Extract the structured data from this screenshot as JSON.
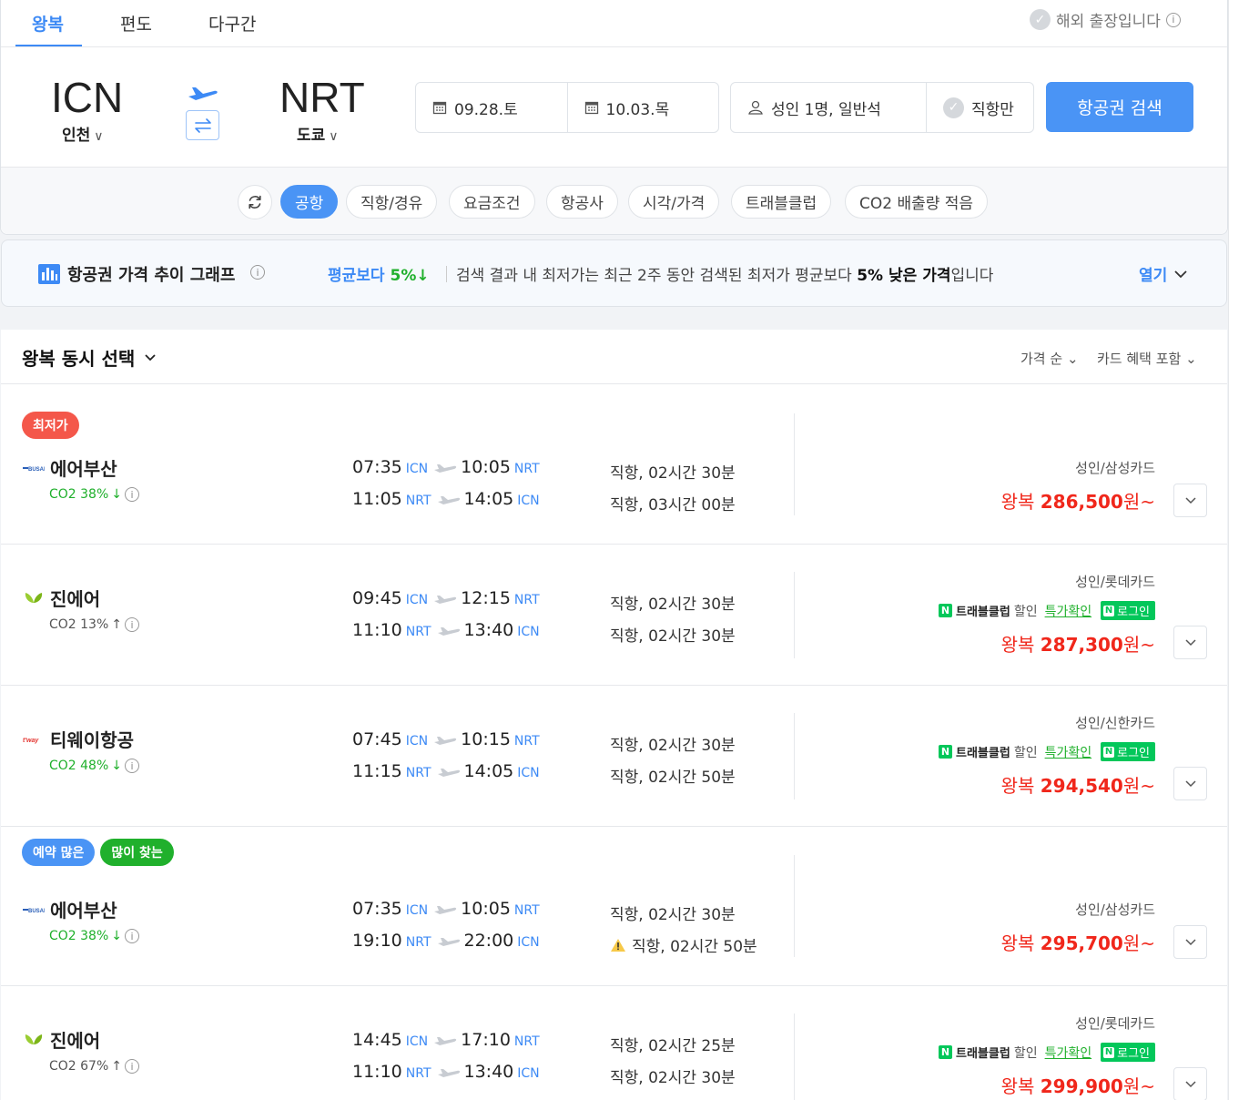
{
  "trip_tabs": [
    "왕복",
    "편도",
    "다구간"
  ],
  "business_trip": {
    "label": "해외 출장입니다"
  },
  "origin": {
    "code": "ICN",
    "city": "인천"
  },
  "destination": {
    "code": "NRT",
    "city": "도쿄"
  },
  "dates": {
    "depart": "09.28.토",
    "return": "10.03.목"
  },
  "passengers": "성인 1명, 일반석",
  "direct_only": "직항만",
  "search_button": "항공권 검색",
  "filters": [
    "공항",
    "직항/경유",
    "요금조건",
    "항공사",
    "시각/가격",
    "트래블클럽",
    "CO2 배출량 적음"
  ],
  "trend": {
    "title": "항공권 가격 추이 그래프",
    "compare_label": "평균보다",
    "compare_pct": "5%",
    "message_pre": "검색 결과 내 최저가는 최근 2주 동안 검색된 최저가 평균보다 ",
    "message_bold": "5% 낮은 가격",
    "message_post": "입니다",
    "open_label": "열기"
  },
  "results_header": {
    "mode": "왕복 동시 선택",
    "sort": "가격 순",
    "card": "카드 혜택 포함"
  },
  "promo": {
    "club": "트래블클럽",
    "discount": "할인",
    "link": "특가확인",
    "login": "로그인"
  },
  "colors": {
    "accent": "#4a94f5",
    "price": "#f0271b",
    "green": "#20b02c",
    "badge_red": "#f4574a"
  },
  "flights": [
    {
      "badges": [
        {
          "text": "최저가",
          "color": "red"
        }
      ],
      "airline": "에어부산",
      "logo": "airbusan-logo",
      "co2": "CO2 38%",
      "co2_dir": "down",
      "out": {
        "dep_time": "07:35",
        "dep_ap": "ICN",
        "arr_time": "10:05",
        "arr_ap": "NRT",
        "dur": "직항, 02시간 30분"
      },
      "ret": {
        "dep_time": "11:05",
        "dep_ap": "NRT",
        "arr_time": "14:05",
        "arr_ap": "ICN",
        "dur": "직항, 03시간 00분"
      },
      "card": "성인/삼성카드",
      "promo": false,
      "price_prefix": "왕복",
      "price": "286,500",
      "price_suffix": "원~"
    },
    {
      "badges": [],
      "airline": "진에어",
      "logo": "jinair-logo",
      "co2": "CO2 13%",
      "co2_dir": "up",
      "out": {
        "dep_time": "09:45",
        "dep_ap": "ICN",
        "arr_time": "12:15",
        "arr_ap": "NRT",
        "dur": "직항, 02시간 30분"
      },
      "ret": {
        "dep_time": "11:10",
        "dep_ap": "NRT",
        "arr_time": "13:40",
        "arr_ap": "ICN",
        "dur": "직항, 02시간 30분"
      },
      "card": "성인/롯데카드",
      "promo": true,
      "price_prefix": "왕복",
      "price": "287,300",
      "price_suffix": "원~"
    },
    {
      "badges": [],
      "airline": "티웨이항공",
      "logo": "tway-logo",
      "co2": "CO2 48%",
      "co2_dir": "down",
      "out": {
        "dep_time": "07:45",
        "dep_ap": "ICN",
        "arr_time": "10:15",
        "arr_ap": "NRT",
        "dur": "직항, 02시간 30분"
      },
      "ret": {
        "dep_time": "11:15",
        "dep_ap": "NRT",
        "arr_time": "14:05",
        "arr_ap": "ICN",
        "dur": "직항, 02시간 50분"
      },
      "card": "성인/신한카드",
      "promo": true,
      "price_prefix": "왕복",
      "price": "294,540",
      "price_suffix": "원~"
    },
    {
      "badges": [
        {
          "text": "예약 많은",
          "color": "blue"
        },
        {
          "text": "많이 찾는",
          "color": "green"
        }
      ],
      "airline": "에어부산",
      "logo": "airbusan-logo",
      "co2": "CO2 38%",
      "co2_dir": "down",
      "out": {
        "dep_time": "07:35",
        "dep_ap": "ICN",
        "arr_time": "10:05",
        "arr_ap": "NRT",
        "dur": "직항, 02시간 30분"
      },
      "ret": {
        "dep_time": "19:10",
        "dep_ap": "NRT",
        "arr_time": "22:00",
        "arr_ap": "ICN",
        "dur": "직항, 02시간 50분",
        "warn": true
      },
      "card": "성인/삼성카드",
      "promo": false,
      "price_prefix": "왕복",
      "price": "295,700",
      "price_suffix": "원~"
    },
    {
      "badges": [],
      "airline": "진에어",
      "logo": "jinair-logo",
      "co2": "CO2 67%",
      "co2_dir": "up",
      "out": {
        "dep_time": "14:45",
        "dep_ap": "ICN",
        "arr_time": "17:10",
        "arr_ap": "NRT",
        "dur": "직항, 02시간 25분"
      },
      "ret": {
        "dep_time": "11:10",
        "dep_ap": "NRT",
        "arr_time": "13:40",
        "arr_ap": "ICN",
        "dur": "직항, 02시간 30분"
      },
      "card": "성인/롯데카드",
      "promo": true,
      "price_prefix": "왕복",
      "price": "299,900",
      "price_suffix": "원~"
    }
  ]
}
